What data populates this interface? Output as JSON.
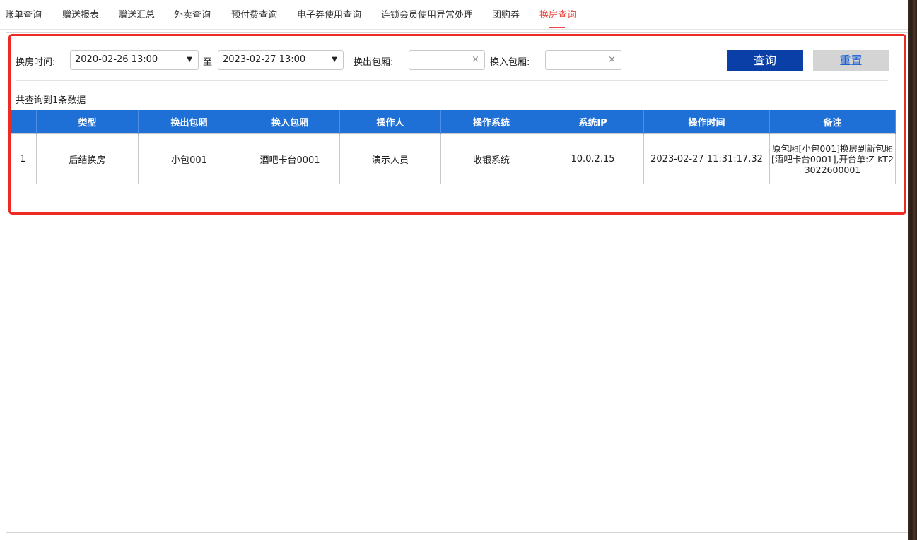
{
  "tabs": [
    {
      "label": "账单查询",
      "active": false
    },
    {
      "label": "赠送报表",
      "active": false
    },
    {
      "label": "赠送汇总",
      "active": false
    },
    {
      "label": "外卖查询",
      "active": false
    },
    {
      "label": "预付费查询",
      "active": false
    },
    {
      "label": "电子券使用查询",
      "active": false
    },
    {
      "label": "连锁会员使用异常处理",
      "active": false
    },
    {
      "label": "团购券",
      "active": false
    },
    {
      "label": "换房查询",
      "active": true
    }
  ],
  "accent_color": "#e8483f",
  "filter": {
    "time_label": "换房时间:",
    "start_time": "2020-02-26 13:00",
    "to_label": "至",
    "end_time": "2023-02-27 13:00",
    "out_room_label": "换出包厢:",
    "out_room_value": "",
    "in_room_label": "换入包厢:",
    "in_room_value": "",
    "clear_icon": "×",
    "query_button": "查询",
    "reset_button": "重置"
  },
  "result_summary": "共查询到1条数据",
  "table": {
    "columns": [
      "",
      "类型",
      "换出包厢",
      "换入包厢",
      "操作人",
      "操作系统",
      "系统IP",
      "操作时间",
      "备注"
    ],
    "rows": [
      {
        "index": "1",
        "type": "后结换房",
        "out_room": "小包001",
        "in_room": "酒吧卡台0001",
        "operator": "演示人员",
        "system": "收银系统",
        "ip": "10.0.2.15",
        "time": "2023-02-27 11:31:17.32",
        "note": "原包厢[小包001]换房到新包厢[酒吧卡台0001],开台单:Z-KT23022600001"
      }
    ]
  }
}
